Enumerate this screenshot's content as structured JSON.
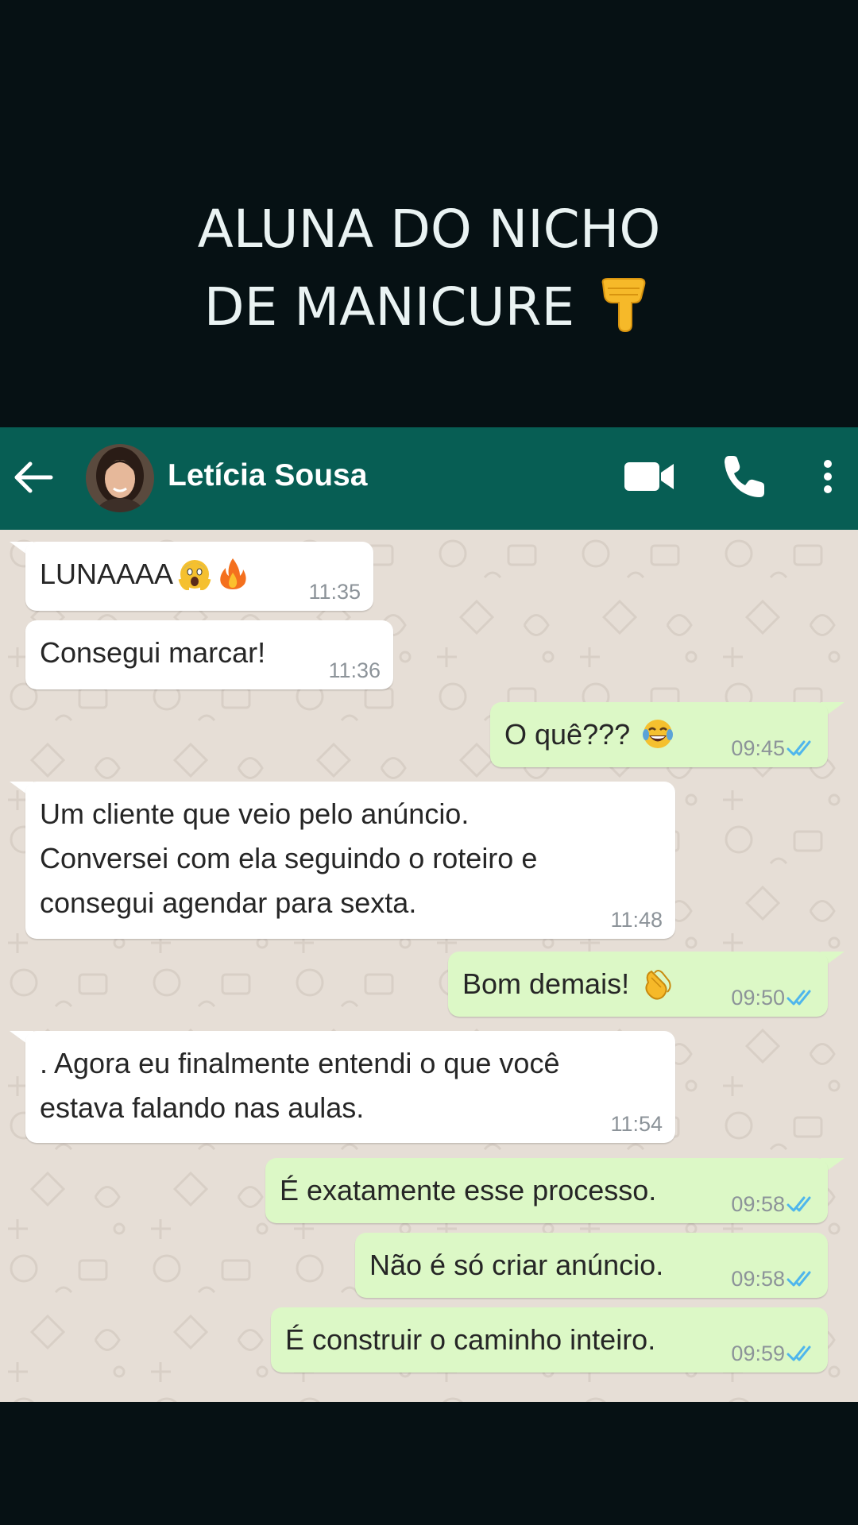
{
  "caption": {
    "line1": "ALUNA DO NICHO",
    "line2": "DE MANICURE",
    "emoji_icon": "pointing-down-hand-icon"
  },
  "header": {
    "back_icon": "arrow-left-icon",
    "avatar": "contact-avatar",
    "contact_name": "Letícia Sousa",
    "icons": [
      "video-camera-icon",
      "phone-icon",
      "more-vertical-icon"
    ],
    "color": "#075e54"
  },
  "messages": [
    {
      "direction": "in",
      "text": "LUNAAAA",
      "emojis": [
        "screaming-face-icon",
        "fire-icon"
      ],
      "time": "11:35"
    },
    {
      "direction": "in",
      "text": "Consegui marcar!",
      "time": "11:36"
    },
    {
      "direction": "out",
      "text": "O quê???",
      "emojis": [
        "laughing-tears-icon"
      ],
      "time": "09:45",
      "status": "read"
    },
    {
      "direction": "in",
      "text": "Um cliente que veio pelo anúncio.\nConversei com ela seguindo o roteiro e\nconsegui agendar para sexta.",
      "time": "11:48"
    },
    {
      "direction": "out",
      "text": "Bom demais!",
      "emojis": [
        "clapping-hands-icon"
      ],
      "time": "09:50",
      "status": "read"
    },
    {
      "direction": "in",
      "text": ". Agora eu finalmente entendi o que você\nestava falando nas aulas.",
      "time": "11:54"
    },
    {
      "direction": "out",
      "text": "É exatamente esse processo.",
      "time": "09:58",
      "status": "read"
    },
    {
      "direction": "out",
      "text": "Não é só criar anúncio.",
      "time": "09:58",
      "status": "read"
    },
    {
      "direction": "out",
      "text": "É construir o caminho inteiro.",
      "time": "09:59",
      "status": "read"
    }
  ],
  "colors": {
    "background": "#061114",
    "chat_background": "#e6ded6",
    "incoming_bubble": "#ffffff",
    "outgoing_bubble": "#dcf8c6",
    "read_ticks": "#4fb6ec"
  }
}
